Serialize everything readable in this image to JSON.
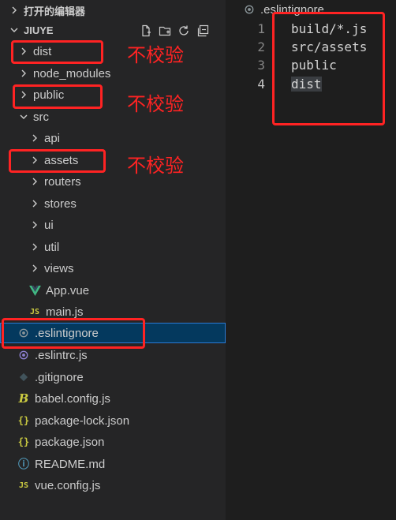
{
  "explorer": {
    "open_editors_label": "打开的编辑器",
    "project_label": "JIUYE",
    "tree": [
      {
        "label": "dist",
        "icon": "folder-chevron-right"
      },
      {
        "label": "node_modules",
        "icon": "folder-chevron-right"
      },
      {
        "label": "public",
        "icon": "folder-chevron-right"
      },
      {
        "label": "src",
        "icon": "folder-chevron-down"
      },
      {
        "label": "api",
        "icon": "folder-chevron-right"
      },
      {
        "label": "assets",
        "icon": "folder-chevron-right"
      },
      {
        "label": "routers",
        "icon": "folder-chevron-right"
      },
      {
        "label": "stores",
        "icon": "folder-chevron-right"
      },
      {
        "label": "ui",
        "icon": "folder-chevron-right"
      },
      {
        "label": "util",
        "icon": "folder-chevron-right"
      },
      {
        "label": "views",
        "icon": "folder-chevron-right"
      },
      {
        "label": "App.vue",
        "icon": "vue-icon"
      },
      {
        "label": "main.js",
        "icon": "js-icon"
      },
      {
        "label": ".eslintignore",
        "icon": "ignore-icon"
      },
      {
        "label": ".eslintrc.js",
        "icon": "eslint-icon"
      },
      {
        "label": ".gitignore",
        "icon": "git-icon"
      },
      {
        "label": "babel.config.js",
        "icon": "babel-icon"
      },
      {
        "label": "package-lock.json",
        "icon": "json-icon"
      },
      {
        "label": "package.json",
        "icon": "json-icon"
      },
      {
        "label": "README.md",
        "icon": "readme-icon"
      },
      {
        "label": "vue.config.js",
        "icon": "js-icon"
      }
    ],
    "selected": ".eslintignore"
  },
  "annotations": {
    "no_check": "不校验"
  },
  "editor": {
    "tab_title": ".eslintignore",
    "lines": [
      {
        "number": "1",
        "text": "build/*.js"
      },
      {
        "number": "2",
        "text": "src/assets"
      },
      {
        "number": "3",
        "text": "public"
      },
      {
        "number": "4",
        "text": "dist"
      }
    ]
  },
  "colors": {
    "annotation_red": "#ff2323",
    "selection_bg": "#04395e",
    "sidebar_bg": "#252526",
    "editor_bg": "#1e1e1e"
  }
}
